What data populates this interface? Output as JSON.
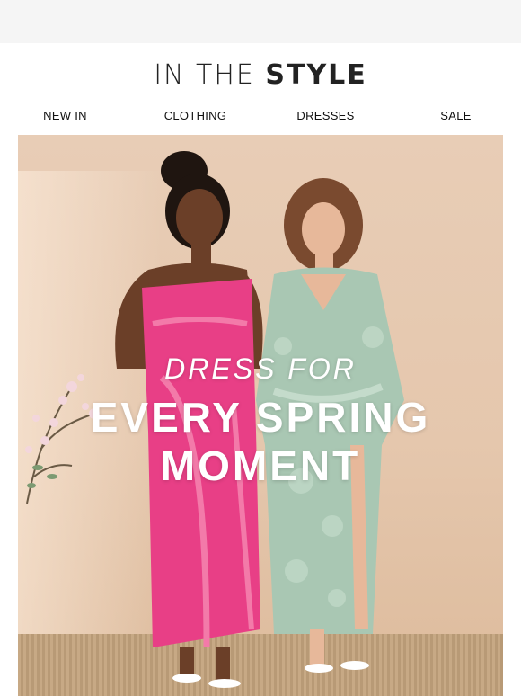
{
  "header": {
    "logo_part1": "IN THE ",
    "logo_part2": "STYLE"
  },
  "nav": {
    "items": [
      "NEW IN",
      "CLOTHING",
      "DRESSES",
      "SALE"
    ]
  },
  "hero": {
    "line1": "DRESS FOR",
    "line2": "EVERY SPRING",
    "line3": "MOMENT",
    "colors": {
      "background": "#e5c7ad",
      "pink_dress": "#e83f86",
      "sage_dress": "#a9c7b3"
    }
  }
}
